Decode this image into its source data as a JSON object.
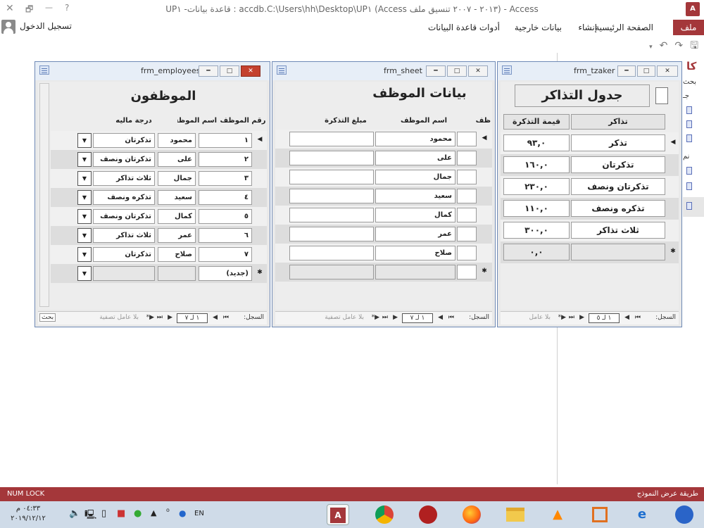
{
  "window": {
    "title": "Access - (٢٠١٣ - ٢٠٠٧ تنسيق ملف Access) accdb.C:\\Users\\hh\\Desktop\\UP١ : قاعدة بيانات- UP١",
    "close_glyph": "✕",
    "restore_glyph": "🗗",
    "minimize_glyph": "—",
    "help_glyph": "?"
  },
  "ribbon": {
    "tabs": [
      "ملف",
      "الصفحة الرئيسية",
      "إنشاء",
      "بيانات خارجية",
      "أدوات قاعدة البيانات"
    ],
    "sign_in": "تسجيل الدخول"
  },
  "nav_pane": {
    "title": "كا",
    "search": "بحث",
    "items": [
      "جـ",
      "نم"
    ]
  },
  "frm_employees": {
    "caption": "frm_employees",
    "heading": "الموظفون",
    "headers": [
      "رقم الموظف",
      "اسم الموظف",
      "درجة ماليه"
    ],
    "rows": [
      {
        "id": "١",
        "name": "محمود",
        "grade": "تذكرتان"
      },
      {
        "id": "٢",
        "name": "على",
        "grade": "تذكرتان ونصف"
      },
      {
        "id": "٣",
        "name": "جمال",
        "grade": "ثلاث تذاكر"
      },
      {
        "id": "٤",
        "name": "سعيد",
        "grade": "تذكره ونصف"
      },
      {
        "id": "٥",
        "name": "كمال",
        "grade": "تذكرتان ونصف"
      },
      {
        "id": "٦",
        "name": "عمر",
        "grade": "ثلاث تذاكر"
      },
      {
        "id": "٧",
        "name": "صلاح",
        "grade": "تذكرتان"
      }
    ],
    "new_row": "(جديد)",
    "nav": {
      "record_label": "السجل:",
      "position": "١ لـ ٧",
      "filter": "بلا عامل تصفية",
      "search": "بحث"
    }
  },
  "frm_sheet": {
    "caption": "frm_sheet",
    "heading": "بيانات الموظف",
    "headers": [
      "ظف",
      "اسم الموظف",
      "مبلغ التذكرة"
    ],
    "rows": [
      "محمود",
      "على",
      "جمال",
      "سعيد",
      "كمال",
      "عمر",
      "صلاح"
    ],
    "nav": {
      "record_label": "السجل:",
      "position": "١ لـ ٧",
      "filter": "بلا عامل تصفية"
    }
  },
  "frm_tzaker": {
    "caption": "frm_tzaker",
    "heading": "جدول التذاكر",
    "headers": [
      "تذاكر",
      "قيمة التذكرة"
    ],
    "rows": [
      {
        "name": "تذكر",
        "value": "٩٣,٠"
      },
      {
        "name": "تذكرتان",
        "value": "١٦٠,٠"
      },
      {
        "name": "تذكرتان ونصف",
        "value": "٢٣٠,٠"
      },
      {
        "name": "تذكره ونصف",
        "value": "١١٠,٠"
      },
      {
        "name": "ثلاث تذاكر",
        "value": "٣٠٠,٠"
      }
    ],
    "new_value": "٠,٠",
    "nav": {
      "record_label": "السجل:",
      "position": "١ لـ ٥",
      "filter": "بلا عامل"
    }
  },
  "status": {
    "left": "NUM LOCK",
    "right": "طريقة عرض النموذج"
  },
  "taskbar": {
    "time": "٠٤:٣٣ م",
    "date": "٢٠١٩/١٢/١٢",
    "lang": "EN"
  }
}
